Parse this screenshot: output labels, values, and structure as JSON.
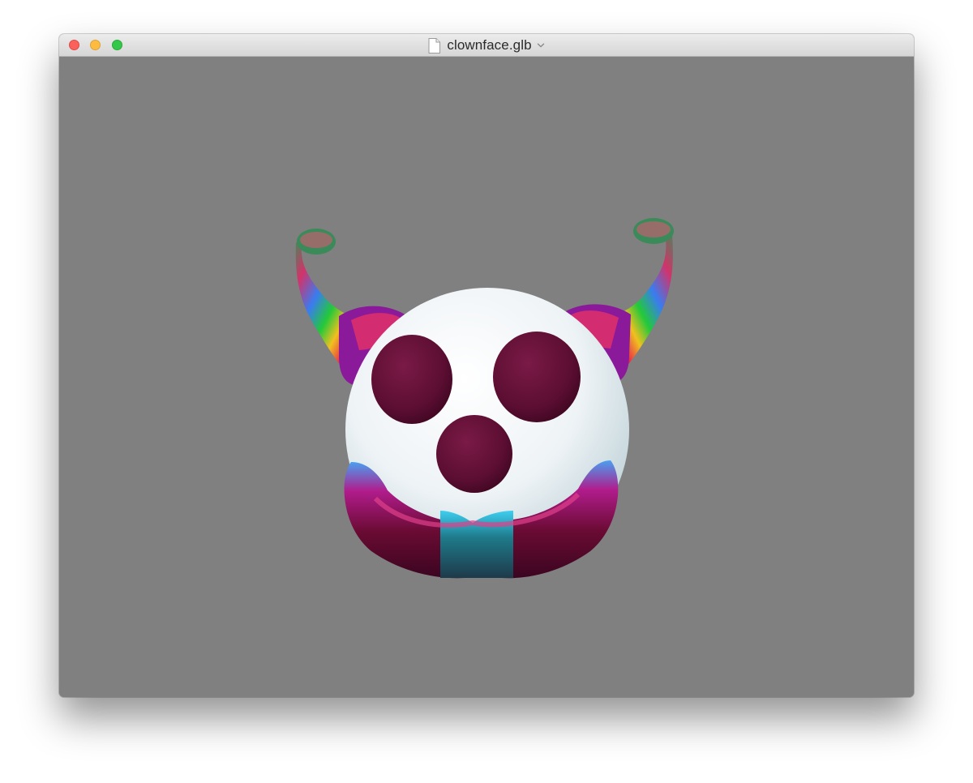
{
  "window": {
    "title": "clownface.glb",
    "icons": {
      "close": "close-dot",
      "minimize": "minimize-dot",
      "zoom": "zoom-dot",
      "document": "document-icon",
      "title_menu": "chevron-down-icon"
    }
  },
  "viewport": {
    "background": "#808080",
    "model": "clown-face"
  }
}
